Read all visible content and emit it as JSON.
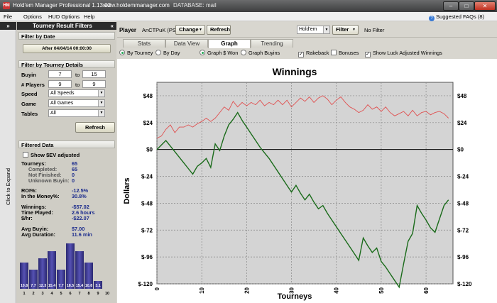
{
  "window": {
    "title": "Hold'em Manager Professional 1.13.02",
    "url": "www.holdemmanager.com",
    "database": "DATABASE: mail",
    "app_icon": "HM",
    "minimize": "–",
    "maximize": "□",
    "close": "✕"
  },
  "menu": {
    "items": [
      "File",
      "Options",
      "HUD Options",
      "Help"
    ],
    "faq": "Suggested FAQs (8)",
    "faq_icon": "?"
  },
  "expand_strip": {
    "chevron": "»",
    "label": "Click to Expand"
  },
  "left_panel": {
    "header": "Tourney Result Filters",
    "collapse": "«",
    "filter_by_date": {
      "title": "Filter by Date",
      "after_button": "After 04/04/14 00:00:00"
    },
    "tourney_details": {
      "title": "Filter by Tourney Details",
      "buyin": {
        "label": "Buyin",
        "from": "7",
        "to_label": "to",
        "to": "15"
      },
      "players": {
        "label": "# Players",
        "from": "9",
        "to_label": "to",
        "to": "9"
      },
      "speed": {
        "label": "Speed",
        "value": "All Speeds"
      },
      "game": {
        "label": "Game",
        "value": "All Games"
      },
      "tables": {
        "label": "Tables",
        "value": "All"
      }
    },
    "refresh": "Refresh",
    "filtered_data": {
      "title": "Filtered Data",
      "show_ev": "Show $EV adjusted",
      "tourneys": {
        "label": "Tourneys:",
        "value": "65"
      },
      "completed": {
        "label": "Completed:",
        "value": "65"
      },
      "not_finished": {
        "label": "Not Finished:",
        "value": "0"
      },
      "unknown_buyin": {
        "label": "Unknown Buyin:",
        "value": "0"
      },
      "roi": {
        "label": "ROI%:",
        "value": "-12.5%"
      },
      "itm": {
        "label": "In the Money%:",
        "value": "30.8%"
      },
      "winnings": {
        "label": "Winnings:",
        "value": "-$57.02"
      },
      "time_played": {
        "label": "Time Played:",
        "value": "2.6 hours"
      },
      "per_hr": {
        "label": "$/hr:",
        "value": "-$22.07"
      },
      "avg_buyin": {
        "label": "Avg Buyin:",
        "value": "$7.00"
      },
      "avg_duration": {
        "label": "Avg Duration:",
        "value": "11.6 min"
      }
    },
    "histogram": {
      "positions": [
        "1",
        "2",
        "3",
        "4",
        "5",
        "6",
        "7",
        "8",
        "9",
        "10"
      ],
      "values": [
        10.8,
        7.7,
        12.3,
        15.4,
        7.7,
        18.5,
        15.4,
        10.8,
        3.1,
        0
      ],
      "labels": [
        "10.8",
        "7.7",
        "12.3",
        "15.4",
        "7.7",
        "18.5",
        "15.4",
        "10.8",
        "3.1",
        ""
      ]
    }
  },
  "toolbar": {
    "player_label": "Player",
    "player_name": "AnCTPuK (PS)",
    "change": "Change",
    "refresh": "Refresh",
    "game": "Hold'em",
    "filter": "Filter",
    "no_filter": "No Filter",
    "dropdown_arrow": "▼"
  },
  "tabs": [
    "Stats",
    "Data View",
    "Graph",
    "Trending"
  ],
  "active_tab": "Graph",
  "graph_options": {
    "by_tourney": "By Tourney",
    "by_day": "By Day",
    "graph_won": "Graph $ Won",
    "graph_buyins": "Graph Buyins",
    "rakeback": "Rakeback",
    "bonuses": "Bonuses",
    "luck_adjusted": "Show Luck Adjusted Winnings",
    "checkmark": "✓"
  },
  "chart_data": {
    "type": "line",
    "title": "Winnings",
    "xlabel": "Tourneys",
    "ylabel": "Dollars",
    "xlim": [
      0,
      66
    ],
    "ylim": [
      -120,
      60
    ],
    "x_ticks": [
      0,
      10,
      20,
      30,
      40,
      50,
      60
    ],
    "y_ticks": [
      -120,
      -96,
      -72,
      -48,
      -24,
      0,
      24,
      48
    ],
    "y_tick_labels": [
      "$-120",
      "$-96",
      "$-72",
      "$-48",
      "$-24",
      "$0",
      "$24",
      "$48"
    ],
    "colors": {
      "winnings": "#1a6b1a",
      "luck_adjusted": "#e05050",
      "plot_bg": "#d4d4d4"
    },
    "series": [
      {
        "key": "winnings",
        "values": [
          0,
          4,
          8,
          3,
          -2,
          -7,
          -12,
          -17,
          -22,
          -15,
          -12,
          -8,
          -16,
          5,
          -1,
          12,
          22,
          27,
          33,
          26,
          20,
          14,
          8,
          2,
          -3,
          -8,
          -14,
          -20,
          -26,
          -32,
          -38,
          -32,
          -39,
          -45,
          -40,
          -47,
          -53,
          -50,
          -57,
          -63,
          -69,
          -75,
          -81,
          -87,
          -93,
          -99,
          -79,
          -86,
          -92,
          -88,
          -100,
          -105,
          -111,
          -117,
          -123,
          -102,
          -82,
          -75,
          -50,
          -57,
          -63,
          -70,
          -74,
          -62,
          -50,
          -45
        ]
      },
      {
        "key": "luck_adjusted",
        "values": [
          10,
          12,
          18,
          22,
          15,
          20,
          20,
          22,
          20,
          23,
          25,
          28,
          25,
          28,
          33,
          38,
          35,
          43,
          38,
          42,
          39,
          42,
          40,
          44,
          39,
          42,
          40,
          44,
          40,
          44,
          38,
          42,
          46,
          43,
          47,
          42,
          46,
          48,
          45,
          40,
          44,
          47,
          42,
          38,
          36,
          33,
          35,
          40,
          36,
          38,
          34,
          38,
          33,
          30,
          32,
          34,
          30,
          35,
          30,
          33,
          34,
          31,
          33,
          34,
          32,
          28
        ]
      }
    ]
  }
}
